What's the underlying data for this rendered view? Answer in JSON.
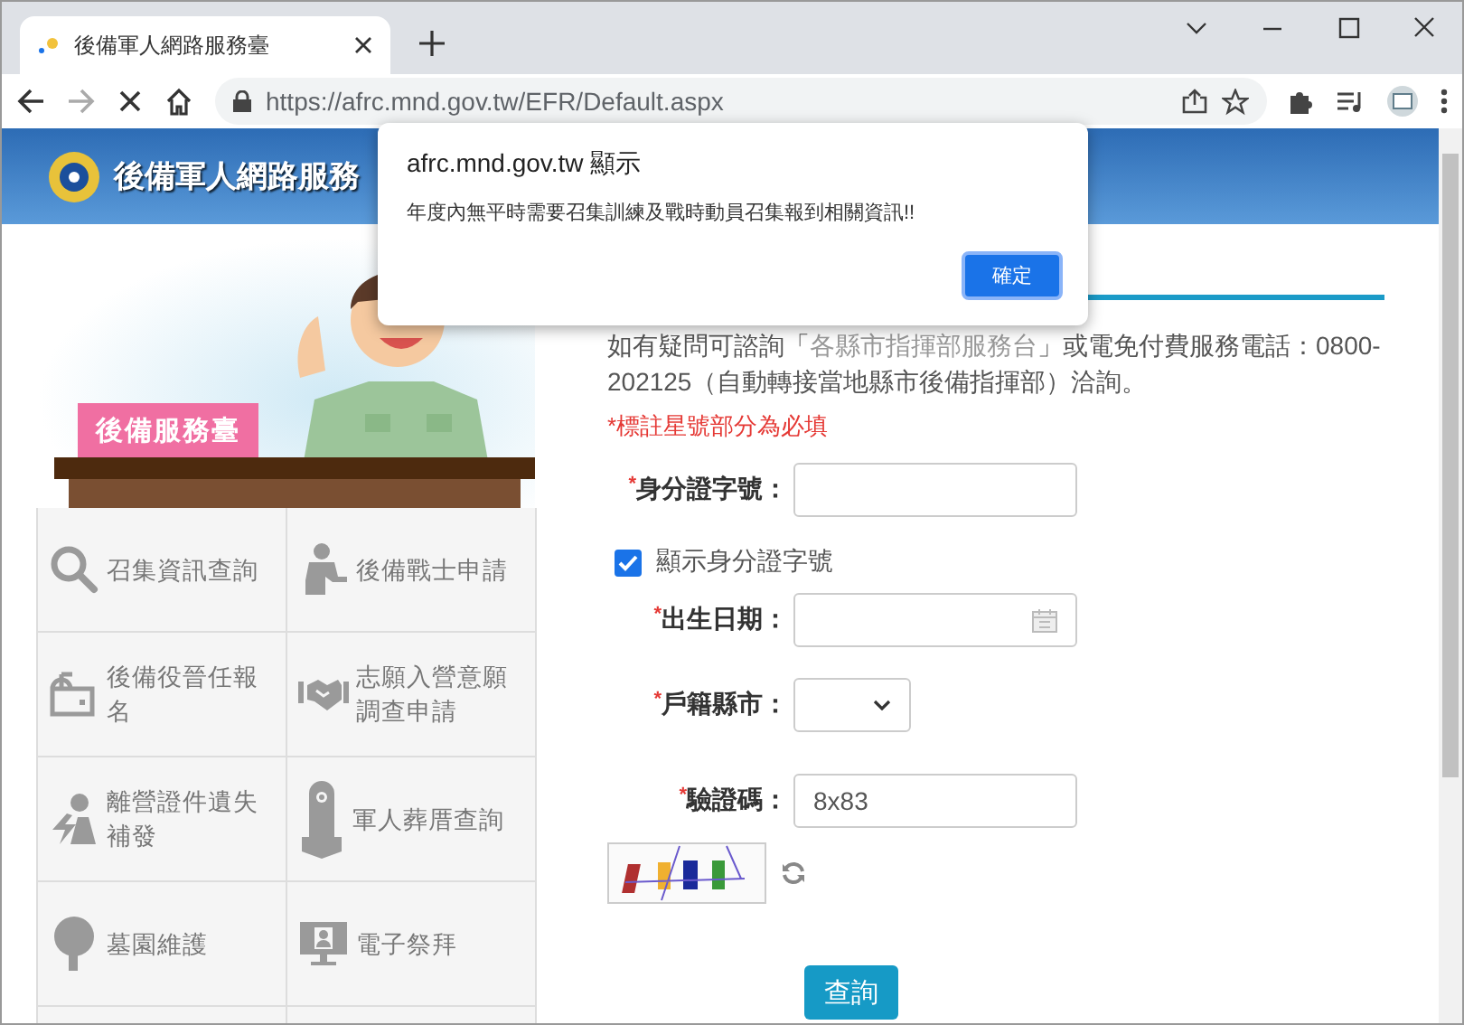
{
  "browser": {
    "tab_title": "後備軍人網路服務臺",
    "url": "https://afrc.mnd.gov.tw/EFR/Default.aspx"
  },
  "banner": {
    "site_title": "後備軍人網路服務"
  },
  "dialog": {
    "title": "afrc.mnd.gov.tw 顯示",
    "message": "年度內無平時需要召集訓練及戰時動員召集報到相關資訊!!",
    "ok_button": "確定"
  },
  "sidebar": {
    "sign": "後備服務臺",
    "items": [
      {
        "label": "召集資訊查詢"
      },
      {
        "label": "後備戰士申請"
      },
      {
        "label": "後備役晉任報名"
      },
      {
        "label": "志願入營意願調查申請"
      },
      {
        "label": "離營證件遺失補發"
      },
      {
        "label": "軍人葬厝查詢"
      },
      {
        "label": "墓園維護"
      },
      {
        "label": "電子祭拜"
      }
    ]
  },
  "form": {
    "info_before": "如有疑問可諮詢「",
    "info_link": "各縣市指揮部服務台",
    "info_after": "」或電免付費服務電話：0800-202125（自動轉接當地縣市後備指揮部）洽詢。",
    "required_note": "*標註星號部分為必填",
    "fields": [
      {
        "kind": "text",
        "label": "身分證字號：",
        "required": true
      },
      {
        "kind": "checkbox",
        "label": "顯示身分證字號",
        "checked": true
      },
      {
        "kind": "date",
        "label": "出生日期：",
        "required": true
      },
      {
        "kind": "select",
        "label": "戶籍縣市：",
        "required": true
      },
      {
        "kind": "text",
        "label": "驗證碼：",
        "required": true,
        "value": "8x83"
      }
    ],
    "required_mark": "*",
    "submit": "查詢"
  }
}
